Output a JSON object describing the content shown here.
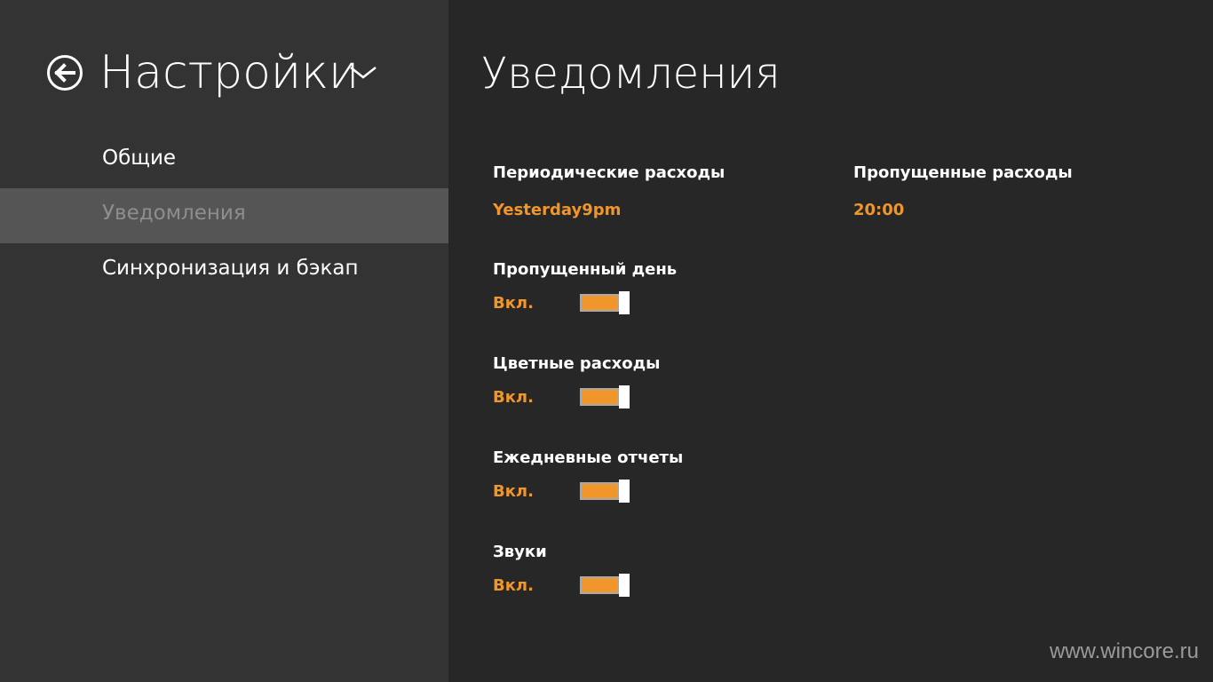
{
  "sidebar": {
    "title": "Настройки",
    "items": [
      {
        "label": "Общие"
      },
      {
        "label": "Уведомления"
      },
      {
        "label": "Синхронизация и бэкап"
      }
    ],
    "selected_item": "Уведомления",
    "back_icon": "back-arrow-circle-icon",
    "title_dropdown_icon": "chevron-down-icon"
  },
  "main": {
    "title": "Уведомления",
    "periodic": {
      "label": "Периодические расходы",
      "value": "Yesterday9pm"
    },
    "missed_expenses": {
      "label": "Пропущенные расходы",
      "value": "20:00"
    },
    "toggles": [
      {
        "label": "Пропущенный день",
        "state_label": "Вкл.",
        "on": true
      },
      {
        "label": "Цветные расходы",
        "state_label": "Вкл.",
        "on": true
      },
      {
        "label": "Ежедневные отчеты",
        "state_label": "Вкл.",
        "on": true
      },
      {
        "label": "Звуки",
        "state_label": "Вкл.",
        "on": true
      }
    ]
  },
  "watermark": "www.wincore.ru",
  "colors": {
    "accent": "#f0962b",
    "sidebar_bg": "#333333",
    "selected_bg": "#555555",
    "main_bg": "#272727"
  }
}
